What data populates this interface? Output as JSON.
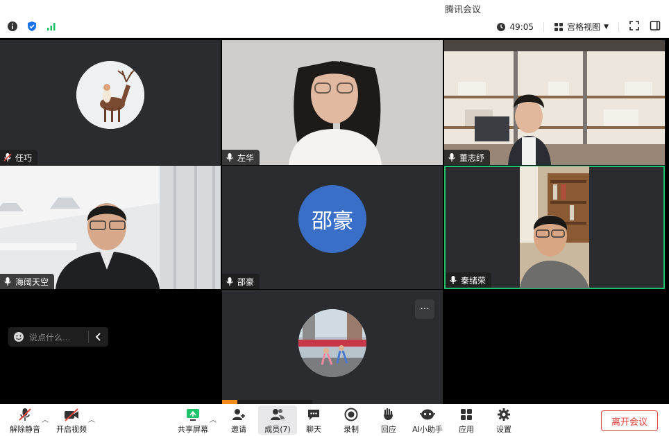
{
  "window": {
    "title": "腾讯会议"
  },
  "infobar": {
    "timer": "49:05",
    "view_label": "宫格视图"
  },
  "participants": [
    {
      "name": "任巧"
    },
    {
      "name": "左华"
    },
    {
      "name": "董志纾"
    },
    {
      "name": "海阔天空"
    },
    {
      "name": "邵豪",
      "avatar_text": "邵豪"
    },
    {
      "name": "秦绪荣"
    }
  ],
  "chat": {
    "placeholder": "说点什么..."
  },
  "more_label": "···",
  "toolbar": {
    "unmute": "解除静音",
    "start_video": "开启视频",
    "share_screen": "共享屏幕",
    "invite": "邀请",
    "members": "成员(7)",
    "chat": "聊天",
    "record": "录制",
    "react": "回应",
    "ai_assistant": "AI小助手",
    "apps": "应用",
    "settings": "设置",
    "leave": "离开会议"
  },
  "colors": {
    "accent": "#1ec26a",
    "leave": "#e0453a",
    "avatar_blue": "#3a6fc8"
  }
}
